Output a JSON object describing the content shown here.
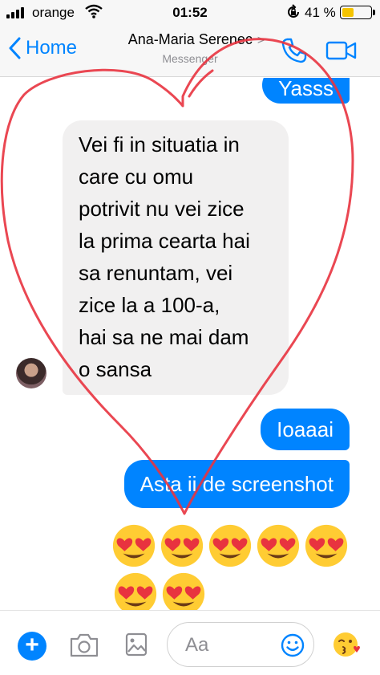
{
  "status_bar": {
    "carrier": "orange",
    "time": "01:52",
    "battery": "41 %",
    "battery_level": 0.41,
    "signal_bars": 4
  },
  "nav": {
    "back_label": "Home",
    "title": "Ana-Maria Serenec",
    "title_chevron": ">",
    "subtitle": "Messenger",
    "icons": [
      "chevron-left-icon",
      "phone-icon",
      "video-camera-icon"
    ]
  },
  "messages": {
    "out_top": "Yasss",
    "incoming_lines": [
      "Vei fi in situatia in",
      "care cu omu",
      "potrivit nu vei zice",
      "la prima cearta hai",
      "sa renuntam, vei",
      "zice la a 100-a,",
      "hai sa ne mai dam",
      "o sansa"
    ],
    "out_1": "Ioaaai",
    "out_2": "Asta ii de screenshot",
    "emoji_name": "heart-eyes-emoji",
    "emoji_count_row1": 5,
    "emoji_count_row2": 2
  },
  "composer": {
    "placeholder": "Aa",
    "icons": [
      "plus-icon",
      "camera-icon",
      "photo-icon",
      "smiley-icon",
      "kissing-emoji-icon"
    ]
  },
  "colors": {
    "accent": "#0084ff",
    "incoming_bubble": "#f1f0f0",
    "drawing": "#e8333f"
  },
  "drawing": "red heart outline drawn over the conversation"
}
